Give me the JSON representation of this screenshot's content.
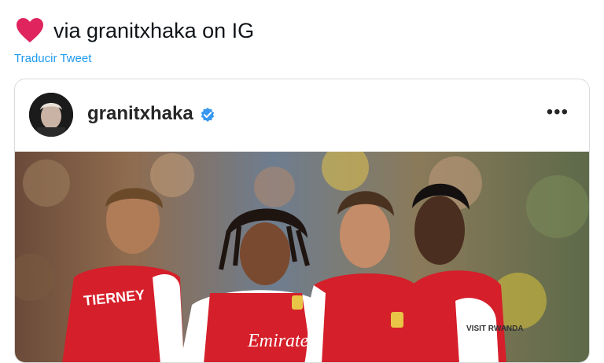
{
  "tweet": {
    "text": "via granitxhaka on IG",
    "heart_icon": "red-heart-icon",
    "translate_label": "Traducir Tweet"
  },
  "instagram_embed": {
    "username": "granitxhaka",
    "verified_icon": "verified-badge-icon",
    "more_icon": "more-options-icon",
    "more_glyph": "•••",
    "photo": {
      "jersey_texts": [
        "TIERNEY",
        "Emirates",
        "VISIT RWANDA"
      ]
    }
  },
  "colors": {
    "accent": "#1d9bf0",
    "verified": "#3897f0",
    "heart": "#e0245e",
    "arsenal_red": "#d51f2a"
  }
}
